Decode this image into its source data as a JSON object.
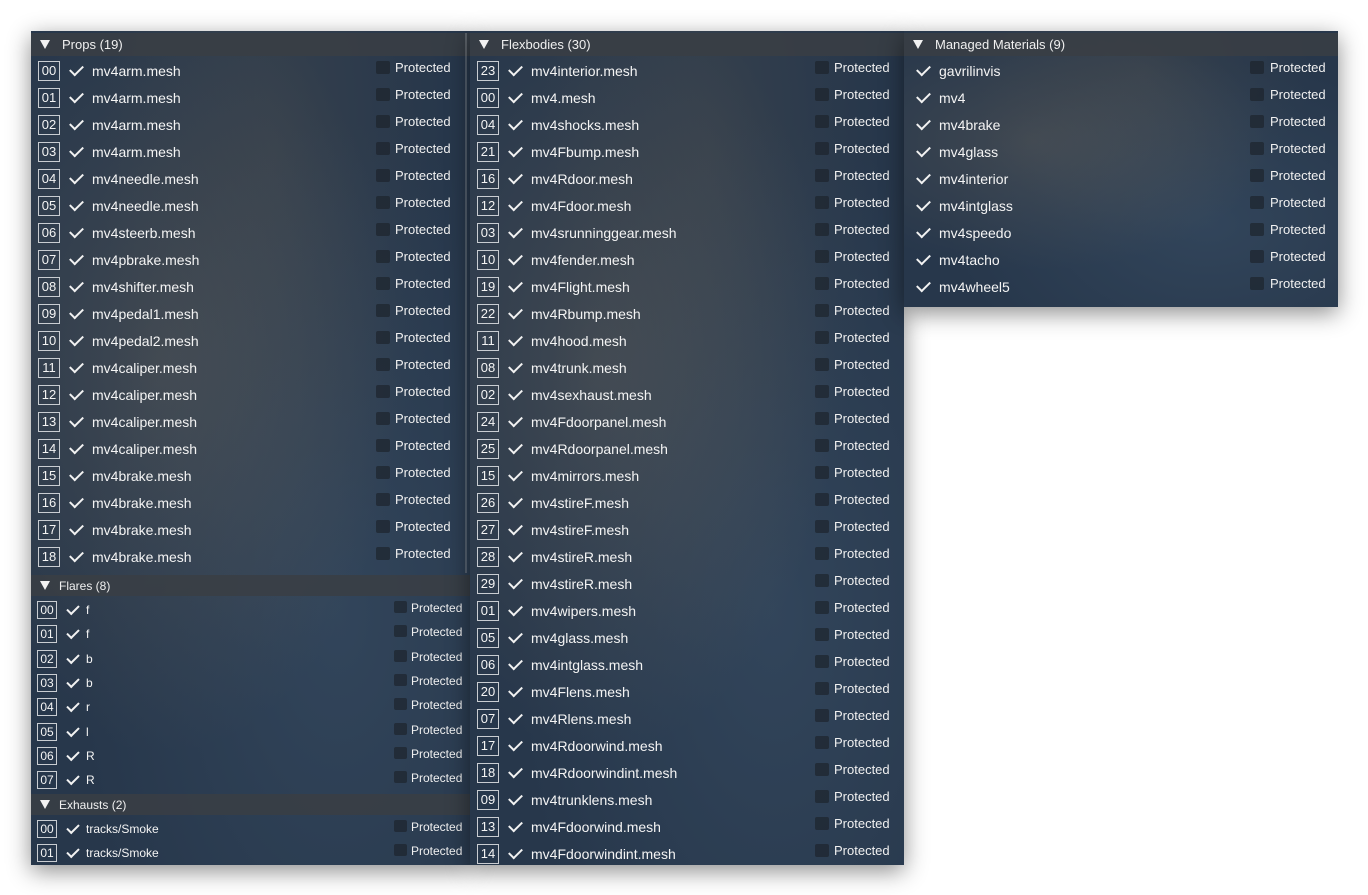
{
  "props": {
    "title": "Props (19)",
    "items": [
      {
        "idx": "00",
        "name": "mv4arm.mesh"
      },
      {
        "idx": "01",
        "name": "mv4arm.mesh"
      },
      {
        "idx": "02",
        "name": "mv4arm.mesh"
      },
      {
        "idx": "03",
        "name": "mv4arm.mesh"
      },
      {
        "idx": "04",
        "name": "mv4needle.mesh"
      },
      {
        "idx": "05",
        "name": "mv4needle.mesh"
      },
      {
        "idx": "06",
        "name": "mv4steerb.mesh"
      },
      {
        "idx": "07",
        "name": "mv4pbrake.mesh"
      },
      {
        "idx": "08",
        "name": "mv4shifter.mesh"
      },
      {
        "idx": "09",
        "name": "mv4pedal1.mesh"
      },
      {
        "idx": "10",
        "name": "mv4pedal2.mesh"
      },
      {
        "idx": "11",
        "name": "mv4caliper.mesh"
      },
      {
        "idx": "12",
        "name": "mv4caliper.mesh"
      },
      {
        "idx": "13",
        "name": "mv4caliper.mesh"
      },
      {
        "idx": "14",
        "name": "mv4caliper.mesh"
      },
      {
        "idx": "15",
        "name": "mv4brake.mesh"
      },
      {
        "idx": "16",
        "name": "mv4brake.mesh"
      },
      {
        "idx": "17",
        "name": "mv4brake.mesh"
      },
      {
        "idx": "18",
        "name": "mv4brake.mesh"
      }
    ]
  },
  "flares": {
    "title": "Flares (8)",
    "items": [
      {
        "idx": "00",
        "name": "f"
      },
      {
        "idx": "01",
        "name": "f"
      },
      {
        "idx": "02",
        "name": "b"
      },
      {
        "idx": "03",
        "name": "b"
      },
      {
        "idx": "04",
        "name": "r"
      },
      {
        "idx": "05",
        "name": "l"
      },
      {
        "idx": "06",
        "name": "R"
      },
      {
        "idx": "07",
        "name": "R"
      }
    ]
  },
  "exhausts": {
    "title": "Exhausts (2)",
    "items": [
      {
        "idx": "00",
        "name": "tracks/Smoke"
      },
      {
        "idx": "01",
        "name": "tracks/Smoke"
      }
    ]
  },
  "flexbodies": {
    "title": "Flexbodies (30)",
    "items": [
      {
        "idx": "23",
        "name": "mv4interior.mesh"
      },
      {
        "idx": "00",
        "name": "mv4.mesh"
      },
      {
        "idx": "04",
        "name": "mv4shocks.mesh"
      },
      {
        "idx": "21",
        "name": "mv4Fbump.mesh"
      },
      {
        "idx": "16",
        "name": "mv4Rdoor.mesh"
      },
      {
        "idx": "12",
        "name": "mv4Fdoor.mesh"
      },
      {
        "idx": "03",
        "name": "mv4srunninggear.mesh"
      },
      {
        "idx": "10",
        "name": "mv4fender.mesh"
      },
      {
        "idx": "19",
        "name": "mv4Flight.mesh"
      },
      {
        "idx": "22",
        "name": "mv4Rbump.mesh"
      },
      {
        "idx": "11",
        "name": "mv4hood.mesh"
      },
      {
        "idx": "08",
        "name": "mv4trunk.mesh"
      },
      {
        "idx": "02",
        "name": "mv4sexhaust.mesh"
      },
      {
        "idx": "24",
        "name": "mv4Fdoorpanel.mesh"
      },
      {
        "idx": "25",
        "name": "mv4Rdoorpanel.mesh"
      },
      {
        "idx": "15",
        "name": "mv4mirrors.mesh"
      },
      {
        "idx": "26",
        "name": "mv4stireF.mesh"
      },
      {
        "idx": "27",
        "name": "mv4stireF.mesh"
      },
      {
        "idx": "28",
        "name": "mv4stireR.mesh"
      },
      {
        "idx": "29",
        "name": "mv4stireR.mesh"
      },
      {
        "idx": "01",
        "name": "mv4wipers.mesh"
      },
      {
        "idx": "05",
        "name": "mv4glass.mesh"
      },
      {
        "idx": "06",
        "name": "mv4intglass.mesh"
      },
      {
        "idx": "20",
        "name": "mv4Flens.mesh"
      },
      {
        "idx": "07",
        "name": "mv4Rlens.mesh"
      },
      {
        "idx": "17",
        "name": "mv4Rdoorwind.mesh"
      },
      {
        "idx": "18",
        "name": "mv4Rdoorwindint.mesh"
      },
      {
        "idx": "09",
        "name": "mv4trunklens.mesh"
      },
      {
        "idx": "13",
        "name": "mv4Fdoorwind.mesh"
      },
      {
        "idx": "14",
        "name": "mv4Fdoorwindint.mesh"
      }
    ]
  },
  "materials": {
    "title": "Managed Materials (9)",
    "items": [
      {
        "name": "gavrilinvis"
      },
      {
        "name": "mv4"
      },
      {
        "name": "mv4brake"
      },
      {
        "name": "mv4glass"
      },
      {
        "name": "mv4interior"
      },
      {
        "name": "mv4intglass"
      },
      {
        "name": "mv4speedo"
      },
      {
        "name": "mv4tacho"
      },
      {
        "name": "mv4wheel5"
      }
    ]
  },
  "protected_label": "Protected"
}
